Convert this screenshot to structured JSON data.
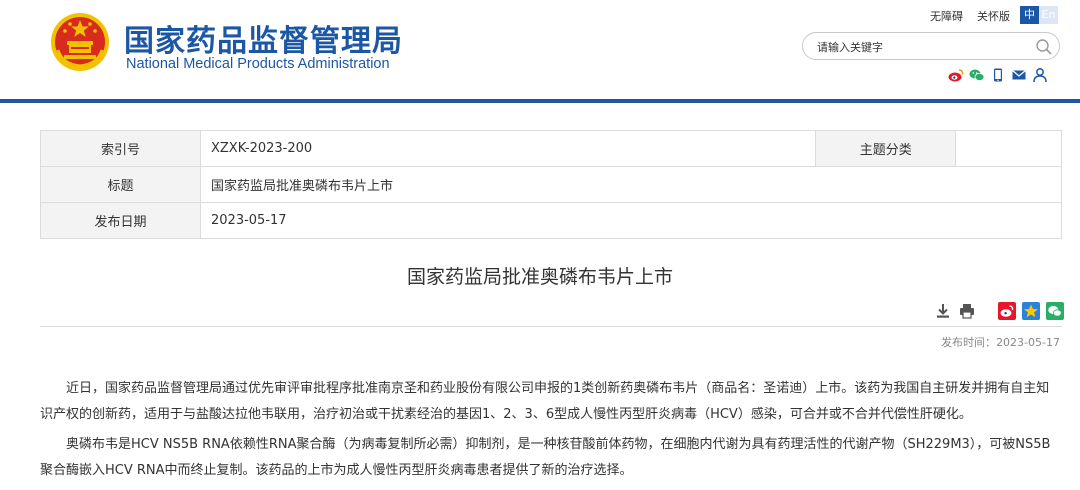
{
  "header": {
    "title_cn": "国家药品监督管理局",
    "title_en": "National Medical Products Administration",
    "accessibility_link": "无障碍",
    "care_mode_link": "关怀版",
    "lang_zh": "中",
    "lang_en": "En",
    "search_placeholder": "请输入关键字",
    "icons": [
      "search-icon",
      "weibo-icon",
      "wechat-icon",
      "mobile-icon",
      "mail-icon",
      "user-icon"
    ]
  },
  "meta": {
    "index_label": "索引号",
    "index_value": "XZXK-2023-200",
    "topic_label": "主题分类",
    "topic_value": "",
    "title_label": "标题",
    "title_value": "国家药监局批准奥磷布韦片上市",
    "date_label": "发布日期",
    "date_value": "2023-05-17"
  },
  "article": {
    "title": "国家药监局批准奥磷布韦片上市",
    "publish_label": "发布时间：",
    "publish_date": "2023-05-17",
    "tools": [
      "download-icon",
      "print-icon",
      "weibo-share-icon",
      "qzone-share-icon",
      "wechat-share-icon"
    ],
    "paragraphs": [
      "近日，国家药品监督管理局通过优先审评审批程序批准南京圣和药业股份有限公司申报的1类创新药奥磷布韦片（商品名：圣诺迪）上市。该药为我国自主研发并拥有自主知识产权的创新药，适用于与盐酸达拉他韦联用，治疗初治或干扰素经治的基因1、2、3、6型成人慢性丙型肝炎病毒（HCV）感染，可合并或不合并代偿性肝硬化。",
      "奥磷布韦是HCV NS5B RNA依赖性RNA聚合酶（为病毒复制所必需）抑制剂，是一种核苷酸前体药物，在细胞内代谢为具有药理活性的代谢产物（SH229M3），可被NS5B聚合酶嵌入HCV RNA中而终止复制。该药品的上市为成人慢性丙型肝炎病毒患者提供了新的治疗选择。"
    ]
  },
  "colors": {
    "brand_blue": "#1c57a5",
    "emblem_red": "#d92a20",
    "emblem_gold": "#f2c200"
  }
}
